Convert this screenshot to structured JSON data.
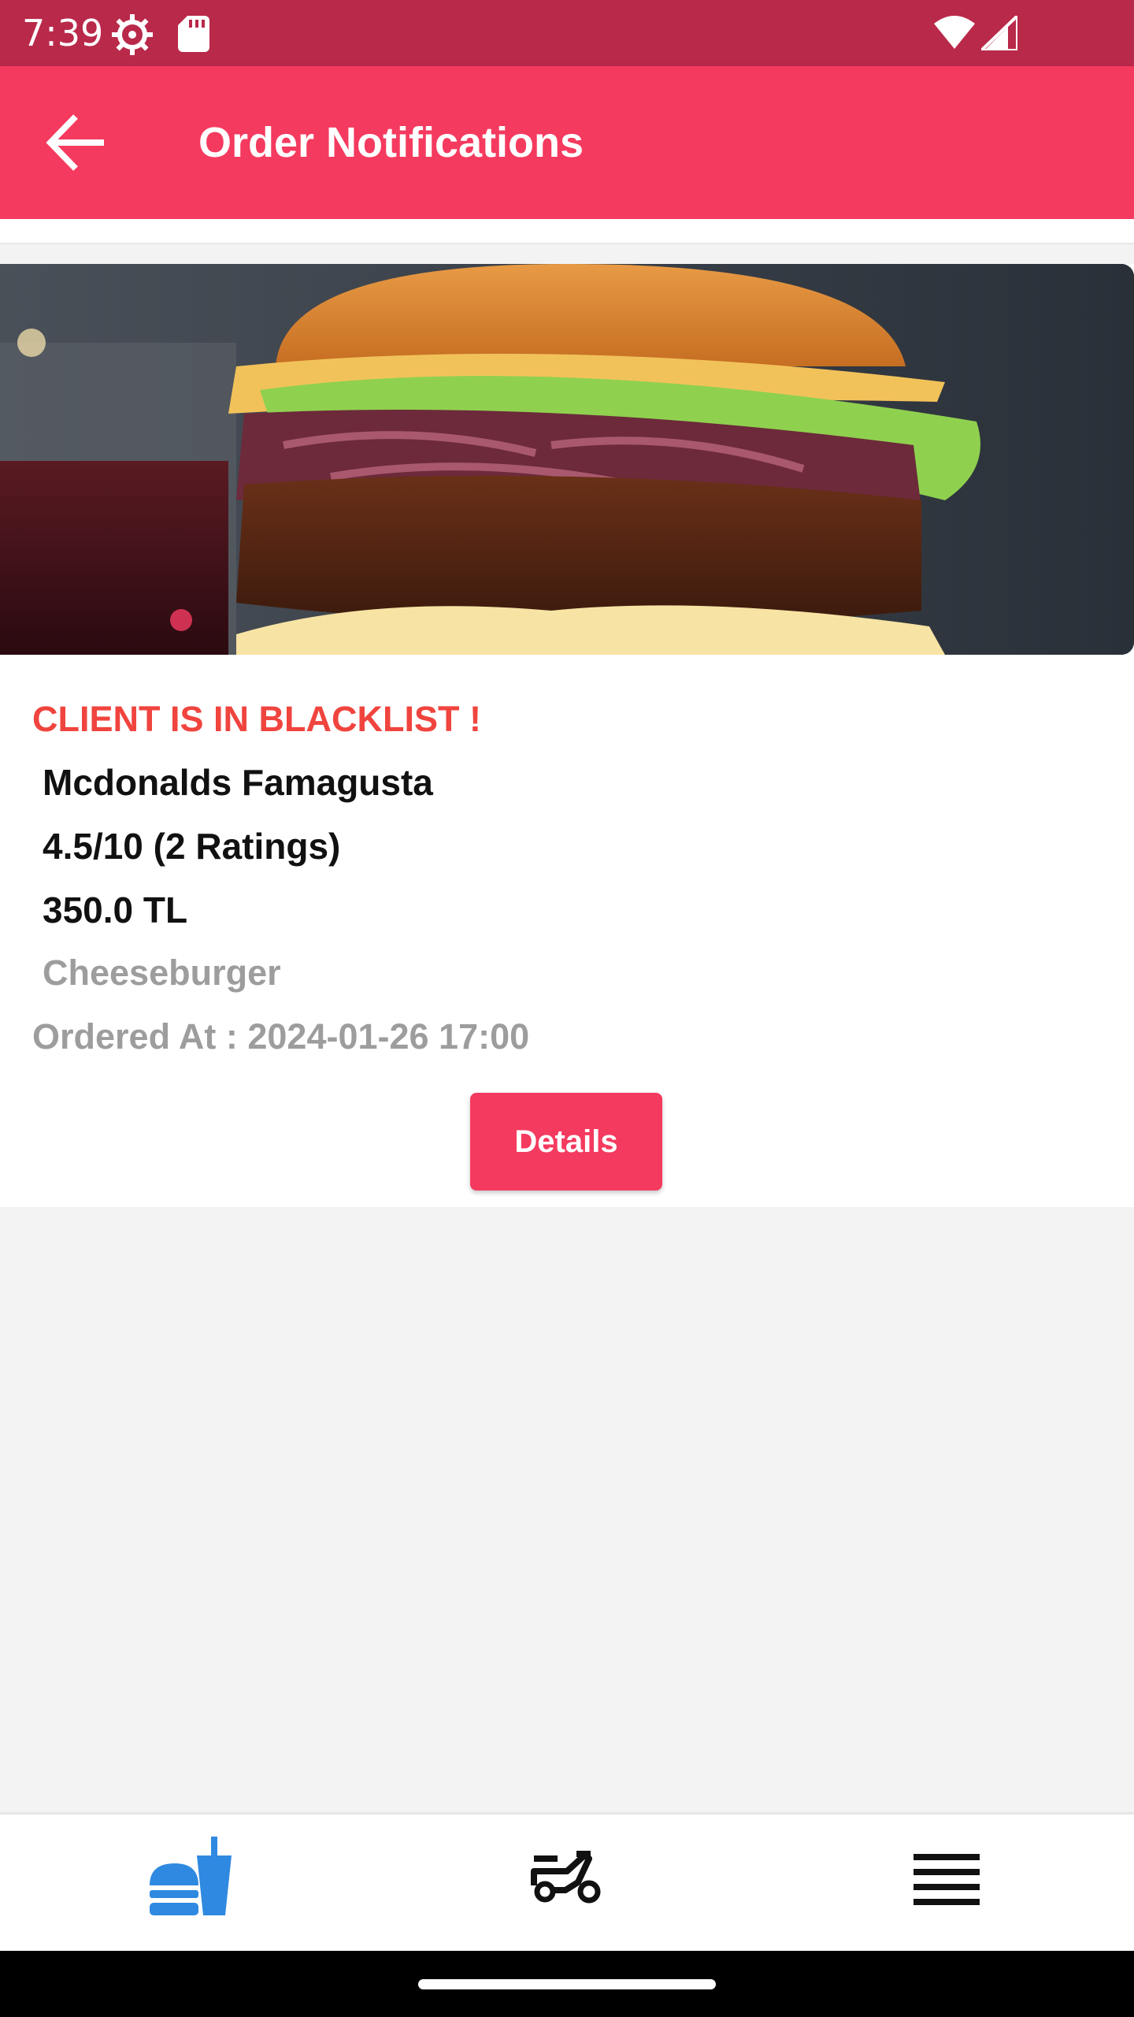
{
  "status_bar": {
    "time": "7:39",
    "left_icons": [
      "gear-icon",
      "sd-card-icon"
    ],
    "right_icons": [
      "wifi-icon",
      "cell-signal-icon"
    ]
  },
  "app_bar": {
    "title": "Order Notifications",
    "back_icon": "arrow-left-icon"
  },
  "order": {
    "warning": "CLIENT IS IN BLACKLIST !",
    "restaurant": "Mcdonalds Famagusta",
    "rating": "4.5/10 (2 Ratings)",
    "price": "350.0 TL",
    "item": "Cheeseburger",
    "ordered_at": "Ordered At : 2024-01-26 17:00",
    "details_label": "Details",
    "image": "burger-photo"
  },
  "bottom_nav": {
    "items": [
      {
        "icon": "fast-food-icon",
        "active": true
      },
      {
        "icon": "moped-icon",
        "active": false
      },
      {
        "icon": "menu-lines-icon",
        "active": false
      }
    ],
    "active_color": "#2f89e0"
  },
  "colors": {
    "status_bar": "#b9294a",
    "app_bar": "#f53a5f",
    "warning": "#f0443e",
    "button": "#f53a5f",
    "background": "#f3f3f3"
  }
}
